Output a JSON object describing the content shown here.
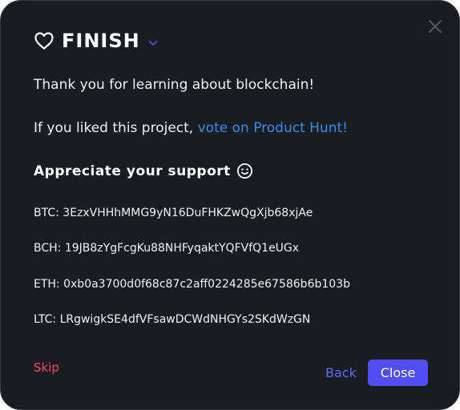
{
  "dialog": {
    "title": "FINISH",
    "thank_you": "Thank you for learning about blockchain!",
    "vote_prefix": "If you liked this project, ",
    "vote_link": "vote on Product Hunt!",
    "support_heading": "Appreciate your support",
    "addresses": [
      {
        "coin": "BTC:",
        "address": "3EzxVHHhMMG9yN16DuFHKZwQgXjb68xjAe"
      },
      {
        "coin": "BCH:",
        "address": "19JB8zYgFcgKu88NHFyqaktYQFVfQ1eUGx"
      },
      {
        "coin": "ETH:",
        "address": "0xb0a3700d0f68c87c2aff0224285e67586b6b103b"
      },
      {
        "coin": "LTC:",
        "address": "LRgwigkSE4dfVFsawDCWdNHGYs2SKdWzGN"
      }
    ],
    "skip_label": "Skip",
    "back_label": "Back",
    "close_label": "Close"
  },
  "icons": {
    "title_icon": "heart-icon",
    "title_dropdown": "chevron-down-icon",
    "support_icon": "smile-icon",
    "dismiss": "close-icon"
  },
  "colors": {
    "background": "#1b1c21",
    "link": "#2e8ff0",
    "skip": "#ee5064",
    "back": "#5b6cf0",
    "primary_button": "#4f4ff5"
  }
}
